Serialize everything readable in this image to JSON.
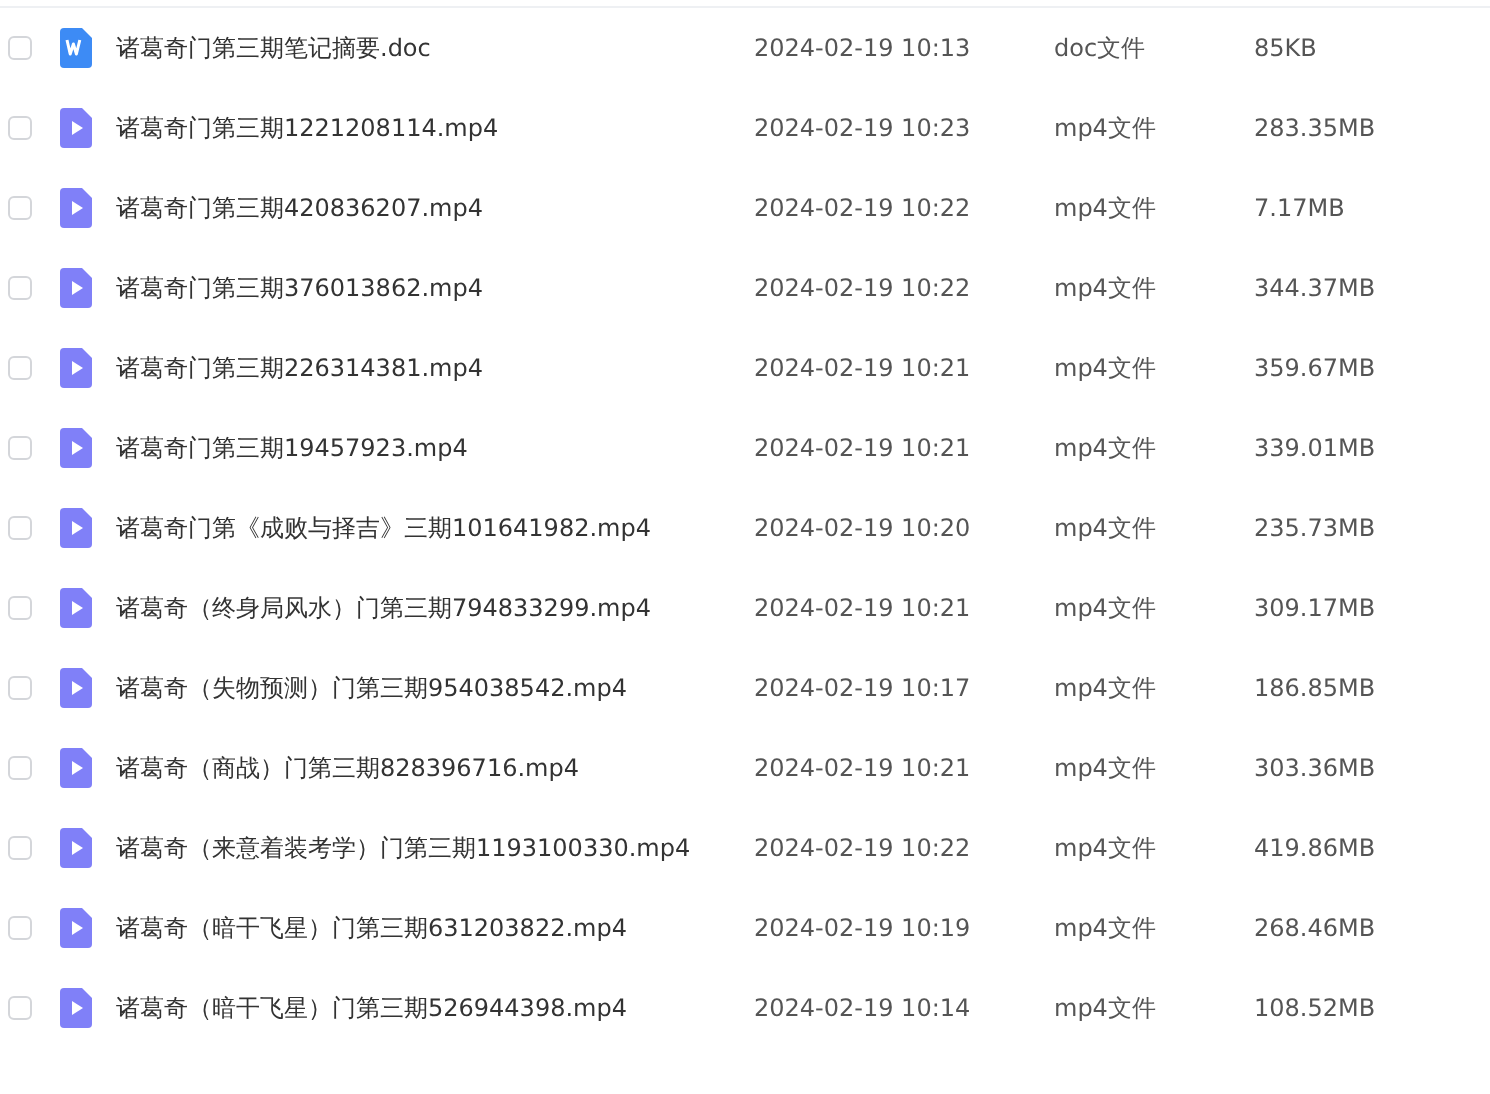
{
  "files": [
    {
      "kind": "doc",
      "name": "诸葛奇门第三期笔记摘要.doc",
      "modified": "2024-02-19 10:13",
      "type": "doc文件",
      "size": "85KB",
      "checked": false
    },
    {
      "kind": "video",
      "name": "诸葛奇门第三期1221208114.mp4",
      "modified": "2024-02-19 10:23",
      "type": "mp4文件",
      "size": "283.35MB",
      "checked": false
    },
    {
      "kind": "video",
      "name": "诸葛奇门第三期420836207.mp4",
      "modified": "2024-02-19 10:22",
      "type": "mp4文件",
      "size": "7.17MB",
      "checked": false
    },
    {
      "kind": "video",
      "name": "诸葛奇门第三期376013862.mp4",
      "modified": "2024-02-19 10:22",
      "type": "mp4文件",
      "size": "344.37MB",
      "checked": false
    },
    {
      "kind": "video",
      "name": "诸葛奇门第三期226314381.mp4",
      "modified": "2024-02-19 10:21",
      "type": "mp4文件",
      "size": "359.67MB",
      "checked": false
    },
    {
      "kind": "video",
      "name": "诸葛奇门第三期19457923.mp4",
      "modified": "2024-02-19 10:21",
      "type": "mp4文件",
      "size": "339.01MB",
      "checked": false
    },
    {
      "kind": "video",
      "name": "诸葛奇门第《成败与择吉》三期101641982.mp4",
      "modified": "2024-02-19 10:20",
      "type": "mp4文件",
      "size": "235.73MB",
      "checked": false
    },
    {
      "kind": "video",
      "name": "诸葛奇（终身局风水）门第三期794833299.mp4",
      "modified": "2024-02-19 10:21",
      "type": "mp4文件",
      "size": "309.17MB",
      "checked": false
    },
    {
      "kind": "video",
      "name": "诸葛奇（失物预测）门第三期954038542.mp4",
      "modified": "2024-02-19 10:17",
      "type": "mp4文件",
      "size": "186.85MB",
      "checked": false
    },
    {
      "kind": "video",
      "name": "诸葛奇（商战）门第三期828396716.mp4",
      "modified": "2024-02-19 10:21",
      "type": "mp4文件",
      "size": "303.36MB",
      "checked": false
    },
    {
      "kind": "video",
      "name": "诸葛奇（来意着装考学）门第三期1193100330.mp4",
      "modified": "2024-02-19 10:22",
      "type": "mp4文件",
      "size": "419.86MB",
      "checked": false
    },
    {
      "kind": "video",
      "name": "诸葛奇（暗干飞星）门第三期631203822.mp4",
      "modified": "2024-02-19 10:19",
      "type": "mp4文件",
      "size": "268.46MB",
      "checked": false
    },
    {
      "kind": "video",
      "name": "诸葛奇（暗干飞星）门第三期526944398.mp4",
      "modified": "2024-02-19 10:14",
      "type": "mp4文件",
      "size": "108.52MB",
      "checked": false
    }
  ]
}
